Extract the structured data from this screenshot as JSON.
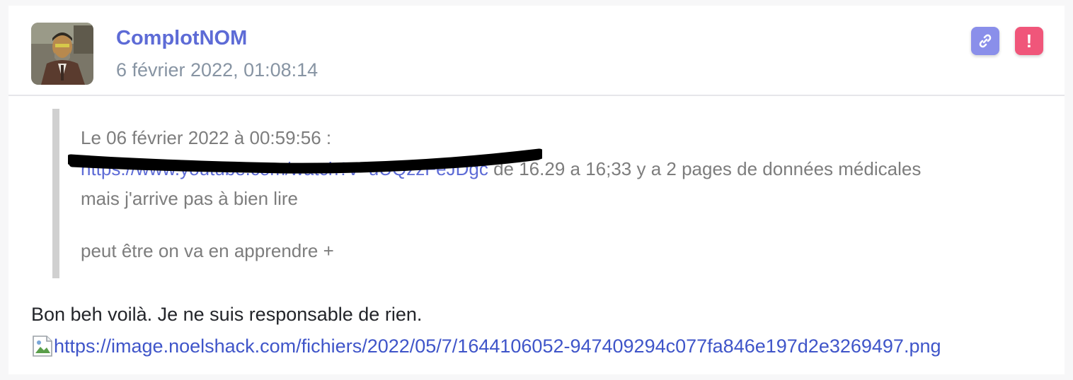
{
  "post": {
    "author": "ComplotNOM",
    "date": "6 février 2022, 01:08:14",
    "actions": {
      "link_icon": "link-icon",
      "report_icon": "exclamation-icon",
      "report_symbol": "!"
    },
    "quote": {
      "header": "Le 06 février 2022 à 00:59:56 :",
      "link_text": "https://www.youtube.com/watch?v=uUQzzFeJDgc",
      "line1_rest": " de 16.29 a 16;33 y a 2 pages de données médicales",
      "line2": "mais j'arrive pas à bien lire",
      "line3": "peut être on va en apprendre +"
    },
    "body": "Bon beh voilà. Je ne suis responsable de rien.",
    "image_link": "https://image.noelshack.com/fichiers/2022/05/7/1644106052-947409294c077fa846e197d2e3269497.png"
  },
  "colors": {
    "author": "#5d6bd6",
    "date": "#8794a3",
    "link_button": "#8a8fea",
    "report_button": "#f0567a",
    "quote_border": "#d0d0d0",
    "quote_text": "#7d7d7d",
    "link": "#3f55c9"
  }
}
